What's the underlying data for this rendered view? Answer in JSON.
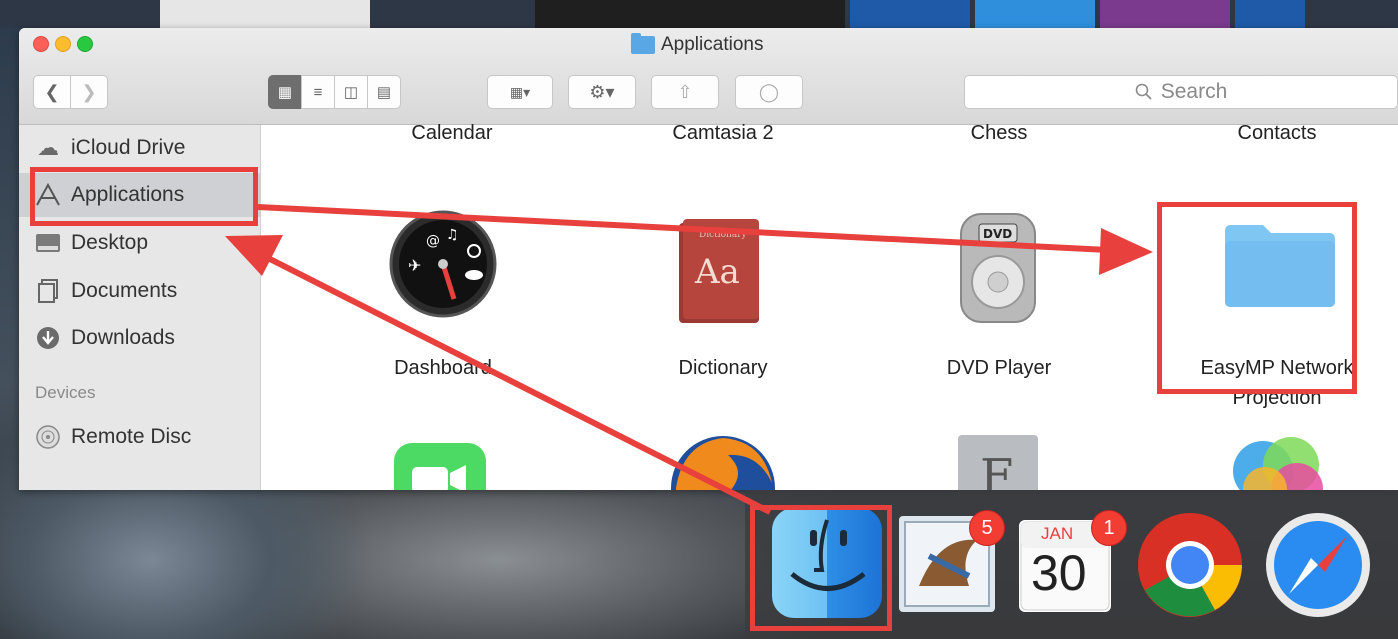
{
  "window": {
    "title": "Applications"
  },
  "toolbar": {
    "search_placeholder": "Search"
  },
  "sidebar": {
    "items": [
      {
        "label": "iCloud Drive",
        "icon": "cloud-icon"
      },
      {
        "label": "Applications",
        "icon": "applications-icon",
        "selected": true
      },
      {
        "label": "Desktop",
        "icon": "desktop-icon"
      },
      {
        "label": "Documents",
        "icon": "documents-icon"
      },
      {
        "label": "Downloads",
        "icon": "downloads-icon"
      }
    ],
    "devices_header": "Devices",
    "devices": [
      {
        "label": "Remote Disc",
        "icon": "disc-icon"
      }
    ]
  },
  "apps": {
    "row1_labels": [
      "Calendar",
      "Camtasia 2",
      "Chess",
      "Contacts"
    ],
    "row2": [
      {
        "label": "Dashboard",
        "icon": "dashboard-icon"
      },
      {
        "label": "Dictionary",
        "icon": "dictionary-icon"
      },
      {
        "label": "DVD Player",
        "icon": "dvd-player-icon"
      },
      {
        "label_line1": "EasyMP Network",
        "label_line2": "Projection",
        "icon": "folder-icon"
      }
    ],
    "row3_icons": [
      "facetime-icon",
      "firefox-icon",
      "font-book-icon",
      "game-center-icon"
    ]
  },
  "dock": {
    "items": [
      {
        "name": "Finder",
        "icon": "finder-icon"
      },
      {
        "name": "Mail",
        "icon": "mail-icon",
        "badge": "5"
      },
      {
        "name": "Calendar",
        "icon": "calendar-icon",
        "badge": "1",
        "month": "JAN",
        "day": "30"
      },
      {
        "name": "Chrome",
        "icon": "chrome-icon"
      },
      {
        "name": "Safari",
        "icon": "safari-icon"
      }
    ]
  },
  "colors": {
    "annotation": "#e8403c",
    "selection": "#cfd0d4",
    "folder": "#5aa7e6"
  }
}
